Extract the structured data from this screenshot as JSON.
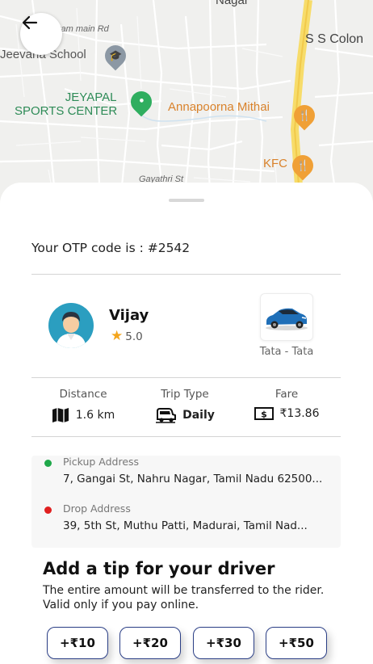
{
  "map": {
    "labels": {
      "nagar": "Nagar",
      "road": "yam main Rd",
      "colony": "S S Colon",
      "school": "Jeevana School",
      "sports_line1": "JEYAPAL",
      "sports_line2": "SPORTS CENTER",
      "restaurant": "Annapoorna Mithai",
      "kfc": "KFC",
      "street": "Gayathri St"
    }
  },
  "back_icon": "arrow-left-icon",
  "otp_text": "Your OTP code is : #2542",
  "driver": {
    "name": "Vijay",
    "rating": "5.0",
    "car": "Tata - Tata"
  },
  "stats": {
    "distance": {
      "label": "Distance",
      "value": "1.6 km",
      "icon": "map-icon"
    },
    "trip_type": {
      "label": "Trip Type",
      "value": "Daily",
      "icon": "taxi-icon"
    },
    "fare": {
      "label": "Fare",
      "value": "₹13.86",
      "icon": "cash-icon"
    }
  },
  "pickup": {
    "label": "Pickup Address",
    "value": "7, Gangai St, Nahru Nagar, Tamil Nadu 62500...",
    "color": "#1fa84a"
  },
  "drop": {
    "label": "Drop Address",
    "value": "39, 5th St, Muthu Patti, Madurai, Tamil Nad...",
    "color": "#e02020"
  },
  "tip": {
    "title": "Add a tip for your driver",
    "description": "The entire amount will be transferred to the rider. Valid only if you pay online.",
    "options": [
      "+₹10",
      "+₹20",
      "+₹30",
      "+₹50"
    ]
  }
}
